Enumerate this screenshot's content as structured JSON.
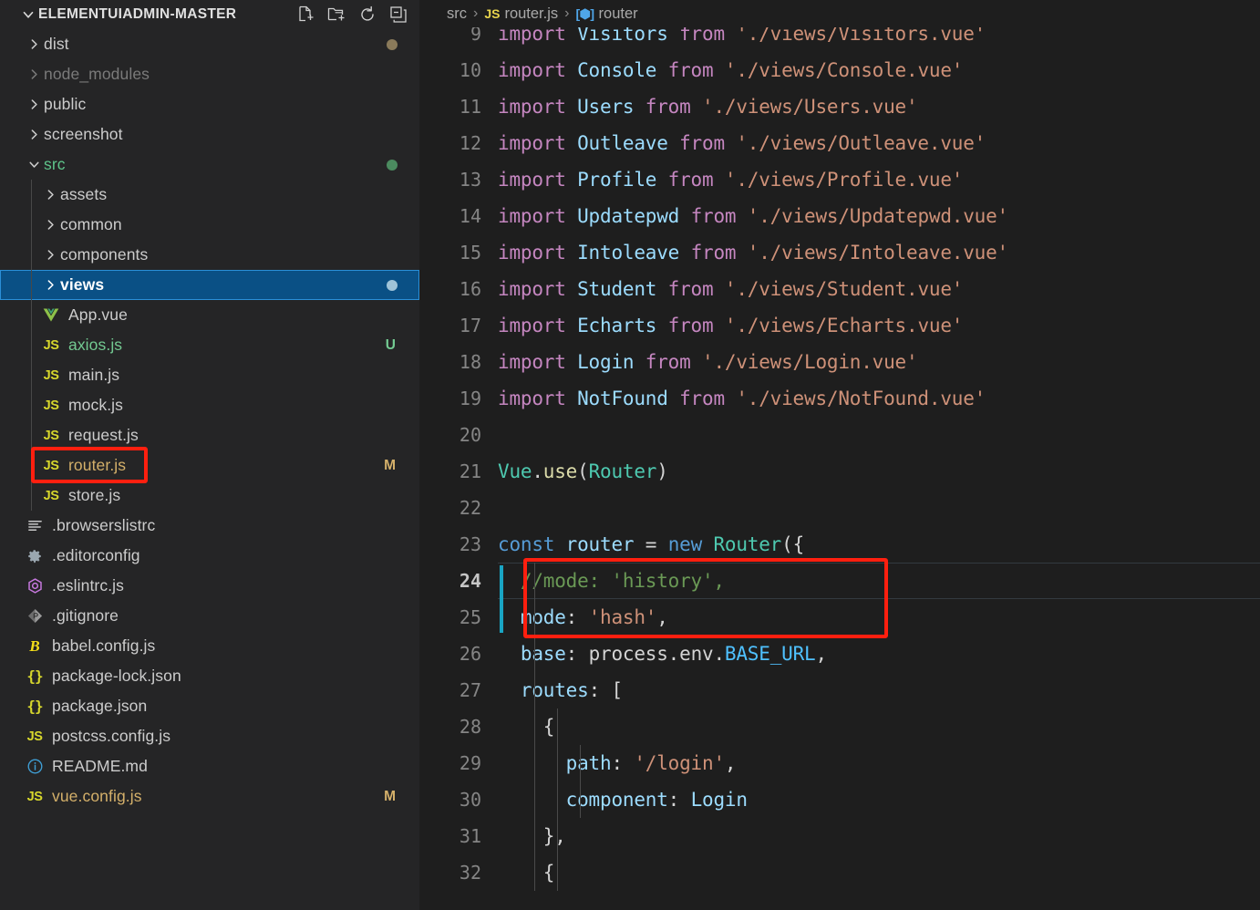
{
  "sidebar": {
    "title": "ELEMENTUIADMIN-MASTER",
    "actions": [
      {
        "name": "new-file-icon",
        "label": "New File"
      },
      {
        "name": "new-folder-icon",
        "label": "New Folder"
      },
      {
        "name": "refresh-icon",
        "label": "Refresh Explorer"
      },
      {
        "name": "collapse-all-icon",
        "label": "Collapse Folders in Explorer"
      }
    ],
    "tree": [
      {
        "label": "dist",
        "type": "folder",
        "expanded": false,
        "indent": 1,
        "badge": "",
        "dot": "#8a7a5a",
        "dim": false
      },
      {
        "label": "node_modules",
        "type": "folder",
        "expanded": false,
        "indent": 1,
        "badge": "",
        "dot": "",
        "dim": true
      },
      {
        "label": "public",
        "type": "folder",
        "expanded": false,
        "indent": 1,
        "badge": "",
        "dot": "",
        "dim": false
      },
      {
        "label": "screenshot",
        "type": "folder",
        "expanded": false,
        "indent": 1,
        "badge": "",
        "dot": "",
        "dim": false
      },
      {
        "label": "src",
        "type": "folder",
        "expanded": true,
        "indent": 1,
        "badge": "",
        "dot": "#4b8b5f",
        "dim": false,
        "color": "#5ec48a"
      },
      {
        "label": "assets",
        "type": "folder",
        "expanded": false,
        "indent": 2,
        "badge": "",
        "dot": "",
        "dim": false
      },
      {
        "label": "common",
        "type": "folder",
        "expanded": false,
        "indent": 2,
        "badge": "",
        "dot": "",
        "dim": false
      },
      {
        "label": "components",
        "type": "folder",
        "expanded": false,
        "indent": 2,
        "badge": "",
        "dot": "",
        "dim": false
      },
      {
        "label": "views",
        "type": "folder",
        "expanded": false,
        "indent": 2,
        "badge": "",
        "dot": "#9fc3d8",
        "dim": false,
        "selected": true
      },
      {
        "label": "App.vue",
        "type": "file",
        "icon": "vue-icon",
        "indent": 2,
        "badge": "",
        "dot": ""
      },
      {
        "label": "axios.js",
        "type": "file",
        "icon": "js-icon",
        "indent": 2,
        "badge": "U",
        "badge_color": "#73c991",
        "color": "#73c991"
      },
      {
        "label": "main.js",
        "type": "file",
        "icon": "js-icon",
        "indent": 2,
        "badge": "",
        "dot": ""
      },
      {
        "label": "mock.js",
        "type": "file",
        "icon": "js-icon",
        "indent": 2,
        "badge": "",
        "dot": ""
      },
      {
        "label": "request.js",
        "type": "file",
        "icon": "js-icon",
        "indent": 2,
        "badge": "",
        "dot": ""
      },
      {
        "label": "router.js",
        "type": "file",
        "icon": "js-icon",
        "indent": 2,
        "badge": "M",
        "badge_color": "#d4b06a",
        "color": "#d4b06a",
        "highlighted": true
      },
      {
        "label": "store.js",
        "type": "file",
        "icon": "js-icon",
        "indent": 2,
        "badge": "",
        "dot": ""
      },
      {
        "label": ".browserslistrc",
        "type": "file",
        "icon": "lines-icon",
        "indent": 1,
        "badge": "",
        "dot": ""
      },
      {
        "label": ".editorconfig",
        "type": "file",
        "icon": "gear-icon",
        "indent": 1,
        "badge": "",
        "dot": ""
      },
      {
        "label": ".eslintrc.js",
        "type": "file",
        "icon": "eslint-icon",
        "indent": 1,
        "badge": "",
        "dot": ""
      },
      {
        "label": ".gitignore",
        "type": "file",
        "icon": "git-icon",
        "indent": 1,
        "badge": "",
        "dot": ""
      },
      {
        "label": "babel.config.js",
        "type": "file",
        "icon": "babel-icon",
        "indent": 1,
        "badge": "",
        "dot": ""
      },
      {
        "label": "package-lock.json",
        "type": "file",
        "icon": "json-icon",
        "indent": 1,
        "badge": "",
        "dot": ""
      },
      {
        "label": "package.json",
        "type": "file",
        "icon": "json-icon",
        "indent": 1,
        "badge": "",
        "dot": ""
      },
      {
        "label": "postcss.config.js",
        "type": "file",
        "icon": "js-icon",
        "indent": 1,
        "badge": "",
        "dot": ""
      },
      {
        "label": "README.md",
        "type": "file",
        "icon": "info-icon",
        "indent": 1,
        "badge": "",
        "dot": ""
      },
      {
        "label": "vue.config.js",
        "type": "file",
        "icon": "js-icon",
        "indent": 1,
        "badge": "M",
        "badge_color": "#d4b06a",
        "color": "#d4b06a"
      }
    ]
  },
  "breadcrumb": {
    "folder": "src",
    "file": "router.js",
    "file_icon": "js-icon",
    "symbol": "router",
    "symbol_icon": "module-symbol-icon",
    "separator": "›"
  },
  "editor": {
    "language": "javascript",
    "active_line": 24,
    "first_visible_line": 9,
    "git_modified_lines": [
      24,
      25
    ],
    "lines": [
      {
        "n": 9,
        "tokens": [
          {
            "t": "import ",
            "c": "k"
          },
          {
            "t": "Visitors",
            "c": "cls"
          },
          {
            "t": " ",
            "c": "pl"
          },
          {
            "t": "from",
            "c": "k"
          },
          {
            "t": " ",
            "c": "pl"
          },
          {
            "t": "'./views/Visitors.vue'",
            "c": "str"
          }
        ]
      },
      {
        "n": 10,
        "tokens": [
          {
            "t": "import ",
            "c": "k"
          },
          {
            "t": "Console",
            "c": "cls"
          },
          {
            "t": " ",
            "c": "pl"
          },
          {
            "t": "from",
            "c": "k"
          },
          {
            "t": " ",
            "c": "pl"
          },
          {
            "t": "'./views/Console.vue'",
            "c": "str"
          }
        ]
      },
      {
        "n": 11,
        "tokens": [
          {
            "t": "import ",
            "c": "k"
          },
          {
            "t": "Users",
            "c": "cls"
          },
          {
            "t": " ",
            "c": "pl"
          },
          {
            "t": "from",
            "c": "k"
          },
          {
            "t": " ",
            "c": "pl"
          },
          {
            "t": "'./views/Users.vue'",
            "c": "str"
          }
        ]
      },
      {
        "n": 12,
        "tokens": [
          {
            "t": "import ",
            "c": "k"
          },
          {
            "t": "Outleave",
            "c": "cls"
          },
          {
            "t": " ",
            "c": "pl"
          },
          {
            "t": "from",
            "c": "k"
          },
          {
            "t": " ",
            "c": "pl"
          },
          {
            "t": "'./views/Outleave.vue'",
            "c": "str"
          }
        ]
      },
      {
        "n": 13,
        "tokens": [
          {
            "t": "import ",
            "c": "k"
          },
          {
            "t": "Profile",
            "c": "cls"
          },
          {
            "t": " ",
            "c": "pl"
          },
          {
            "t": "from",
            "c": "k"
          },
          {
            "t": " ",
            "c": "pl"
          },
          {
            "t": "'./views/Profile.vue'",
            "c": "str"
          }
        ]
      },
      {
        "n": 14,
        "tokens": [
          {
            "t": "import ",
            "c": "k"
          },
          {
            "t": "Updatepwd",
            "c": "cls"
          },
          {
            "t": " ",
            "c": "pl"
          },
          {
            "t": "from",
            "c": "k"
          },
          {
            "t": " ",
            "c": "pl"
          },
          {
            "t": "'./views/Updatepwd.vue'",
            "c": "str"
          }
        ]
      },
      {
        "n": 15,
        "tokens": [
          {
            "t": "import ",
            "c": "k"
          },
          {
            "t": "Intoleave",
            "c": "cls"
          },
          {
            "t": " ",
            "c": "pl"
          },
          {
            "t": "from",
            "c": "k"
          },
          {
            "t": " ",
            "c": "pl"
          },
          {
            "t": "'./views/Intoleave.vue'",
            "c": "str"
          }
        ]
      },
      {
        "n": 16,
        "tokens": [
          {
            "t": "import ",
            "c": "k"
          },
          {
            "t": "Student",
            "c": "cls"
          },
          {
            "t": " ",
            "c": "pl"
          },
          {
            "t": "from",
            "c": "k"
          },
          {
            "t": " ",
            "c": "pl"
          },
          {
            "t": "'./views/Student.vue'",
            "c": "str"
          }
        ]
      },
      {
        "n": 17,
        "tokens": [
          {
            "t": "import ",
            "c": "k"
          },
          {
            "t": "Echarts",
            "c": "cls"
          },
          {
            "t": " ",
            "c": "pl"
          },
          {
            "t": "from",
            "c": "k"
          },
          {
            "t": " ",
            "c": "pl"
          },
          {
            "t": "'./views/Echarts.vue'",
            "c": "str"
          }
        ]
      },
      {
        "n": 18,
        "tokens": [
          {
            "t": "import ",
            "c": "k"
          },
          {
            "t": "Login",
            "c": "cls"
          },
          {
            "t": " ",
            "c": "pl"
          },
          {
            "t": "from",
            "c": "k"
          },
          {
            "t": " ",
            "c": "pl"
          },
          {
            "t": "'./views/Login.vue'",
            "c": "str"
          }
        ]
      },
      {
        "n": 19,
        "tokens": [
          {
            "t": "import ",
            "c": "k"
          },
          {
            "t": "NotFound",
            "c": "cls"
          },
          {
            "t": " ",
            "c": "pl"
          },
          {
            "t": "from",
            "c": "k"
          },
          {
            "t": " ",
            "c": "pl"
          },
          {
            "t": "'./views/NotFound.vue'",
            "c": "str"
          }
        ]
      },
      {
        "n": 20,
        "tokens": []
      },
      {
        "n": 21,
        "tokens": [
          {
            "t": "Vue",
            "c": "ty"
          },
          {
            "t": ".",
            "c": "pl"
          },
          {
            "t": "use",
            "c": "fn"
          },
          {
            "t": "(",
            "c": "pl"
          },
          {
            "t": "Router",
            "c": "ty"
          },
          {
            "t": ")",
            "c": "pl"
          }
        ]
      },
      {
        "n": 22,
        "tokens": []
      },
      {
        "n": 23,
        "tokens": [
          {
            "t": "const ",
            "c": "kw"
          },
          {
            "t": "router",
            "c": "cls"
          },
          {
            "t": " = ",
            "c": "pl"
          },
          {
            "t": "new ",
            "c": "kw"
          },
          {
            "t": "Router",
            "c": "ty"
          },
          {
            "t": "({",
            "c": "pl"
          }
        ]
      },
      {
        "n": 24,
        "tokens": [
          {
            "t": "  //mode: 'history',",
            "c": "cm"
          }
        ]
      },
      {
        "n": 25,
        "tokens": [
          {
            "t": "  ",
            "c": "pl"
          },
          {
            "t": "mode",
            "c": "cls"
          },
          {
            "t": ": ",
            "c": "pl"
          },
          {
            "t": "'hash'",
            "c": "str"
          },
          {
            "t": ",",
            "c": "pl"
          }
        ]
      },
      {
        "n": 26,
        "tokens": [
          {
            "t": "  ",
            "c": "pl"
          },
          {
            "t": "base",
            "c": "cls"
          },
          {
            "t": ": ",
            "c": "pl"
          },
          {
            "t": "process",
            "c": "pl"
          },
          {
            "t": ".",
            "c": "pl"
          },
          {
            "t": "env",
            "c": "pl"
          },
          {
            "t": ".",
            "c": "pl"
          },
          {
            "t": "BASE_URL",
            "c": "cst"
          },
          {
            "t": ",",
            "c": "pl"
          }
        ]
      },
      {
        "n": 27,
        "tokens": [
          {
            "t": "  ",
            "c": "pl"
          },
          {
            "t": "routes",
            "c": "cls"
          },
          {
            "t": ": [",
            "c": "pl"
          }
        ]
      },
      {
        "n": 28,
        "tokens": [
          {
            "t": "    {",
            "c": "pl"
          }
        ]
      },
      {
        "n": 29,
        "tokens": [
          {
            "t": "      ",
            "c": "pl"
          },
          {
            "t": "path",
            "c": "cls"
          },
          {
            "t": ": ",
            "c": "pl"
          },
          {
            "t": "'/login'",
            "c": "str"
          },
          {
            "t": ",",
            "c": "pl"
          }
        ]
      },
      {
        "n": 30,
        "tokens": [
          {
            "t": "      ",
            "c": "pl"
          },
          {
            "t": "component",
            "c": "cls"
          },
          {
            "t": ": ",
            "c": "pl"
          },
          {
            "t": "Login",
            "c": "cls"
          }
        ]
      },
      {
        "n": 31,
        "tokens": [
          {
            "t": "    },",
            "c": "pl"
          }
        ]
      },
      {
        "n": 32,
        "tokens": [
          {
            "t": "    {",
            "c": "pl"
          }
        ]
      }
    ]
  },
  "annotations": {
    "sidebar_highlight_target": "router.js",
    "code_highlight_lines": "24-25",
    "highlight_color": "#ff1f0f"
  }
}
